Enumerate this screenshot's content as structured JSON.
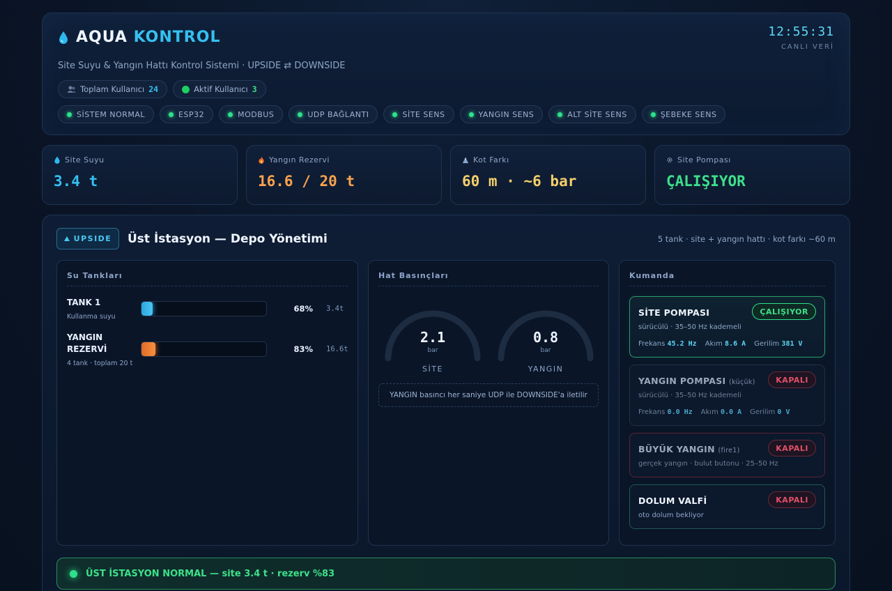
{
  "header": {
    "brand_part1": "AQUA",
    "brand_part2": "KONTROL",
    "clock": "12:55:31",
    "clock_sub": "CANLI VERİ",
    "subtitle": "Site Suyu & Yangın Hattı Kontrol Sistemi  ·  UPSIDE ⇄ DOWNSIDE",
    "users": [
      {
        "label": "Toplam Kullanıcı",
        "value": "24",
        "icon": "users-icon"
      },
      {
        "label": "Aktif Kullanıcı",
        "value": "3",
        "icon": "active-dot-icon"
      }
    ],
    "statuses": [
      "SİSTEM NORMAL",
      "ESP32",
      "MODBUS",
      "UDP BAĞLANTI",
      "SİTE SENS",
      "YANGIN SENS",
      "ALT SİTE SENS",
      "ŞEBEKE SENS"
    ]
  },
  "stats": [
    {
      "label": "Site Suyu",
      "value": "3.4 t",
      "icon": "drop-icon",
      "color": "#35c0f0"
    },
    {
      "label": "Yangın Rezervi",
      "value": "16.6 / 20 t",
      "icon": "fire-icon",
      "color": "#f7a34e"
    },
    {
      "label": "Kot Farkı",
      "value": "60 m · ~6 bar",
      "icon": "mountain-icon",
      "color": "#f4cf6b"
    },
    {
      "label": "Site Pompası",
      "value": "ÇALIŞIYOR",
      "icon": "gear-icon",
      "color": "#3ee08a"
    }
  ],
  "main": {
    "tag": "UPSIDE",
    "title": "Üst İstasyon — Depo Yönetimi",
    "meta": "5 tank · site + yangın hattı · kot farkı ~60 m"
  },
  "tanks": {
    "title": "Su Tankları",
    "items": [
      {
        "name": "TANK 1",
        "sub": "Kullanma suyu",
        "level": 0.09,
        "pct": "68%",
        "tons": "3.4t",
        "color": "#35c0f0"
      },
      {
        "name": "YANGIN REZERVİ",
        "sub": "4 tank · toplam 20 t",
        "level": 0.11,
        "pct": "83%",
        "tons": "16.6t",
        "color": "#f7913e"
      }
    ]
  },
  "pressures": {
    "title": "Hat Basınçları",
    "gauges": [
      {
        "value": "2.1",
        "unit": "bar",
        "name": "SİTE"
      },
      {
        "value": "0.8",
        "unit": "bar",
        "name": "YANGIN"
      }
    ],
    "note": "YANGIN basıncı her saniye UDP ile DOWNSIDE'a iletilir"
  },
  "command": {
    "title": "Kumanda",
    "site_pump": {
      "name": "SİTE POMPASI",
      "status": "ÇALIŞIYOR",
      "desc": "sürücülü · 35–50 Hz kademeli",
      "freq_label": "Frekans",
      "freq": "45.2 Hz",
      "amp_label": "Akım",
      "amp": "8.6 A",
      "volt_label": "Gerilim",
      "volt": "381 V"
    },
    "fire_pump": {
      "name": "YANGIN POMPASI",
      "small": "(küçük)",
      "status": "KAPALI",
      "desc": "sürücülü · 35–50 Hz kademeli",
      "freq_label": "Frekans",
      "freq": "0.0 Hz",
      "amp_label": "Akım",
      "amp": "0.0 A",
      "volt_label": "Gerilim",
      "volt": "0 V"
    },
    "big_fire": {
      "name": "BÜYÜK YANGIN",
      "small": "(fire1)",
      "status": "KAPALI",
      "desc": "gerçek yangın · bulut butonu · 25–50 Hz"
    },
    "fill_valve": {
      "name": "DOLUM VALFİ",
      "status": "KAPALI",
      "desc": "oto dolum bekliyor"
    }
  },
  "banner": {
    "text": "ÜST İSTASYON NORMAL — site 3.4 t · rezerv %83"
  }
}
